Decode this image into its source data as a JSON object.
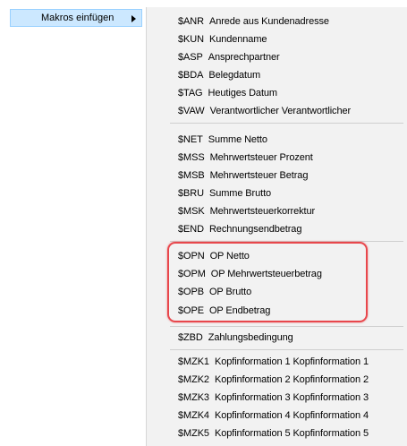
{
  "parent_menu": {
    "label": "Makros einfügen",
    "arrow_icon": "chevron-right-icon"
  },
  "submenu": {
    "group1": [
      {
        "code": "$ANR",
        "label": "Anrede aus Kundenadresse"
      },
      {
        "code": "$KUN",
        "label": "Kundenname"
      },
      {
        "code": "$ASP",
        "label": "Ansprechpartner"
      },
      {
        "code": "$BDA",
        "label": "Belegdatum"
      },
      {
        "code": "$TAG",
        "label": "Heutiges Datum"
      },
      {
        "code": "$VAW",
        "label": "Verantwortlicher Verantwortlicher"
      }
    ],
    "group2": [
      {
        "code": "$NET",
        "label": "Summe Netto"
      },
      {
        "code": "$MSS",
        "label": "Mehrwertsteuer Prozent"
      },
      {
        "code": "$MSB",
        "label": "Mehrwertsteuer Betrag"
      },
      {
        "code": "$BRU",
        "label": "Summe Brutto"
      },
      {
        "code": "$MSK",
        "label": "Mehrwertsteuerkorrektur"
      },
      {
        "code": "$END",
        "label": "Rechnungsendbetrag"
      }
    ],
    "group3": [
      {
        "code": "$OPN",
        "label": "OP Netto"
      },
      {
        "code": "$OPM",
        "label": "OP Mehrwertsteuerbetrag"
      },
      {
        "code": "$OPB",
        "label": "OP Brutto"
      },
      {
        "code": "$OPE",
        "label": "OP Endbetrag"
      }
    ],
    "group4": [
      {
        "code": "$ZBD",
        "label": "Zahlungsbedingung"
      }
    ],
    "group5": [
      {
        "code": "$MZK1",
        "label": "Kopfinformation 1 Kopfinformation 1"
      },
      {
        "code": "$MZK2",
        "label": "Kopfinformation 2 Kopfinformation 2"
      },
      {
        "code": "$MZK3",
        "label": "Kopfinformation 3 Kopfinformation 3"
      },
      {
        "code": "$MZK4",
        "label": "Kopfinformation 4 Kopfinformation 4"
      },
      {
        "code": "$MZK5",
        "label": "Kopfinformation 5 Kopfinformation 5"
      }
    ]
  },
  "colors": {
    "highlight_border": "#e8474c",
    "parent_selected_bg": "#cce8ff",
    "menu_bg": "#f2f2f2"
  }
}
